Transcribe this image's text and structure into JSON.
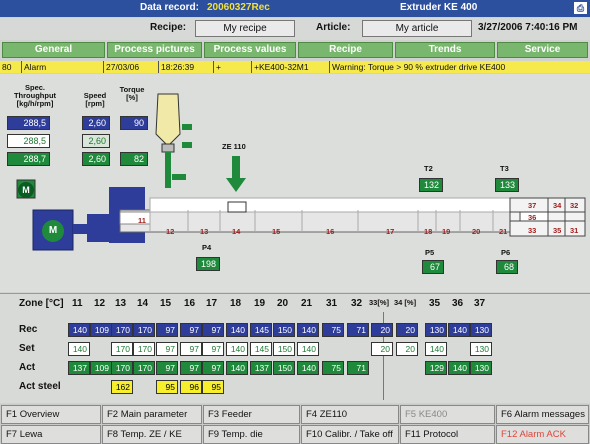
{
  "title_bar": {
    "record_label": "Data record:",
    "record_value": "20060327Rec",
    "machine": "Extruder KE 400",
    "print_icon": "printer-icon"
  },
  "recipe_bar": {
    "recipe_label": "Recipe:",
    "recipe_value": "My recipe",
    "article_label": "Article:",
    "article_value": "My article",
    "datetime": "3/27/2006 7:40:16 PM"
  },
  "tabs": [
    "General",
    "Process pictures",
    "Process values",
    "Recipe",
    "Trends",
    "Service"
  ],
  "alarm": {
    "code": "80",
    "type": "Alarm",
    "date": "27/03/06",
    "time": "18:26:39",
    "flag": "+",
    "source": "+KE400-32M1",
    "message": "Warning: Torque > 90 % extruder drive KE400"
  },
  "drive": {
    "headers": {
      "throughput": "Spec. Throughput [kg/h/rpm]",
      "speed": "Speed [rpm]",
      "torque": "Torque [%]"
    },
    "throughput": [
      "288,5",
      "288,5",
      "288,7"
    ],
    "speed": [
      "2,60",
      "2,60",
      "2,60"
    ],
    "torque": [
      "90",
      "82"
    ]
  },
  "diagram": {
    "motor_label": "M",
    "ze_label": "ZE 110",
    "zones": [
      "11",
      "12",
      "13",
      "14",
      "15",
      "16",
      "17",
      "18",
      "19",
      "20",
      "21",
      "31",
      "32",
      "33",
      "34",
      "35",
      "36",
      "37"
    ],
    "sensors": {
      "T2": "132",
      "T3": "133",
      "P4": "198",
      "P5": "67",
      "P6": "68"
    }
  },
  "grid": {
    "zone_label": "Zone [°C]",
    "headers": [
      "11",
      "12",
      "13",
      "14",
      "15",
      "16",
      "17",
      "18",
      "19",
      "20",
      "21",
      "31",
      "32",
      "33[%]",
      "34 [%]",
      "35",
      "36",
      "37"
    ],
    "rows": [
      {
        "label": "Rec",
        "values": [
          "140",
          "109",
          "170",
          "170",
          "97",
          "97",
          "97",
          "140",
          "145",
          "150",
          "140",
          "75",
          "71",
          "20",
          "20",
          "130",
          "140",
          "130"
        ]
      },
      {
        "label": "Set",
        "values": [
          "140",
          "",
          "170",
          "170",
          "97",
          "97",
          "97",
          "140",
          "145",
          "150",
          "140",
          "",
          "",
          "20",
          "20",
          "140",
          "",
          "130"
        ]
      },
      {
        "label": "Act",
        "values": [
          "137",
          "109",
          "170",
          "170",
          "97",
          "97",
          "97",
          "140",
          "137",
          "150",
          "140",
          "75",
          "71",
          "",
          "",
          "129",
          "140",
          "130"
        ]
      },
      {
        "label": "Act steel",
        "values": [
          "",
          "",
          "162",
          "",
          "95",
          "96",
          "95",
          "",
          "",
          "",
          "",
          "",
          "",
          "",
          "",
          "",
          "",
          ""
        ]
      }
    ]
  },
  "fkeys": [
    [
      "F1 Overview",
      "F2 Main parameter",
      "F3 Feeder",
      "F4 ZE110",
      "F5 KE400",
      "F6 Alarm messages"
    ],
    [
      "F7 Lewa",
      "F8 Temp. ZE / KE",
      "F9 Temp. die",
      "F10 Calibr. / Take off",
      "F11 Protocol",
      "F12 Alarm ACK"
    ]
  ]
}
